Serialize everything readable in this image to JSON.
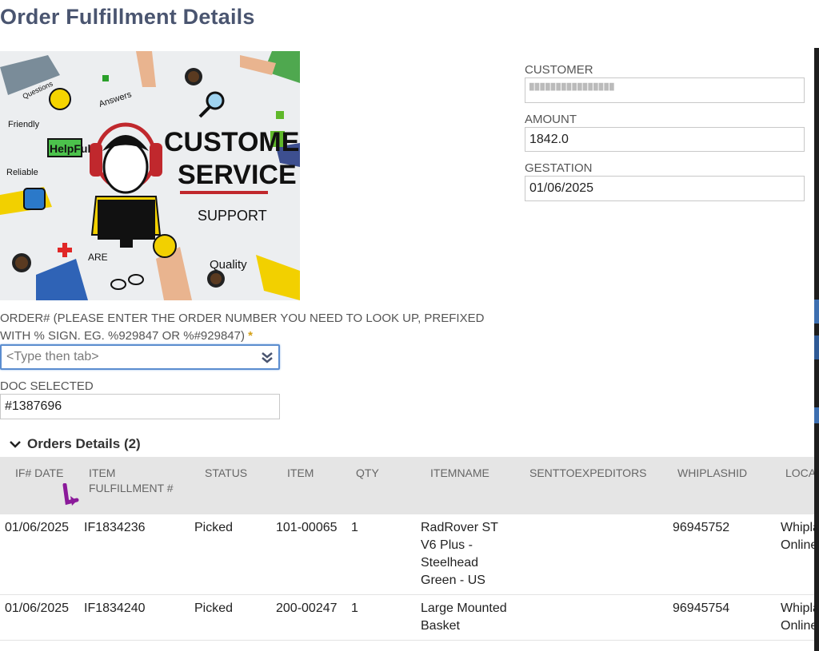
{
  "page": {
    "title": "Order Fulfillment Details"
  },
  "hero": {
    "alt": "Customer Service collage",
    "texts": {
      "customer": "CUSTOMER",
      "service": "SERVICE",
      "support": "SUPPORT",
      "helpful": "HelpFul",
      "friendly": "Friendly",
      "reliable": "Reliable",
      "quality": "Quality",
      "answers": "Answers",
      "questions": "Questions",
      "care": "ARE"
    }
  },
  "fields": {
    "customer": {
      "label": "CUSTOMER",
      "value": "████████████████"
    },
    "amount": {
      "label": "AMOUNT",
      "value": "1842.0"
    },
    "gestation": {
      "label": "GESTATION",
      "value": "01/06/2025"
    },
    "order": {
      "label": "ORDER# (PLEASE ENTER THE ORDER NUMBER YOU NEED TO LOOK UP, PREFIXED WITH % SIGN. EG. %929847 OR %#929847)",
      "required_mark": "*",
      "placeholder": "<Type then tab>"
    },
    "doc_selected": {
      "label": "DOC SELECTED",
      "value": "#1387696"
    }
  },
  "orders_section": {
    "title": "Orders Details (2)",
    "columns": [
      "IF# DATE",
      "ITEM FULFILLMENT #",
      "STATUS",
      "ITEM",
      "QTY",
      "ITEMNAME",
      "SENTTOEXPEDITORS",
      "WHIPLASHID",
      "LOCATION"
    ],
    "rows": [
      {
        "date": "01/06/2025",
        "if_num": "IF1834236",
        "status": "Picked",
        "item": "101-00065",
        "qty": "1",
        "itemname": "RadRover ST V6 Plus - Steelhead Green - US",
        "sent": "",
        "whiplash": "96945752",
        "location": "Whiplash Online"
      },
      {
        "date": "01/06/2025",
        "if_num": "IF1834240",
        "status": "Picked",
        "item": "200-00247",
        "qty": "1",
        "itemname": "Large Mounted Basket",
        "sent": "",
        "whiplash": "96945754",
        "location": "Whiplash Online"
      }
    ]
  },
  "colors": {
    "title": "#4a5570",
    "focus_border": "#5b8dcf",
    "header_bg": "#e5e5e5",
    "required": "#d4a017",
    "annotation_arrow": "#8b1a9a"
  }
}
